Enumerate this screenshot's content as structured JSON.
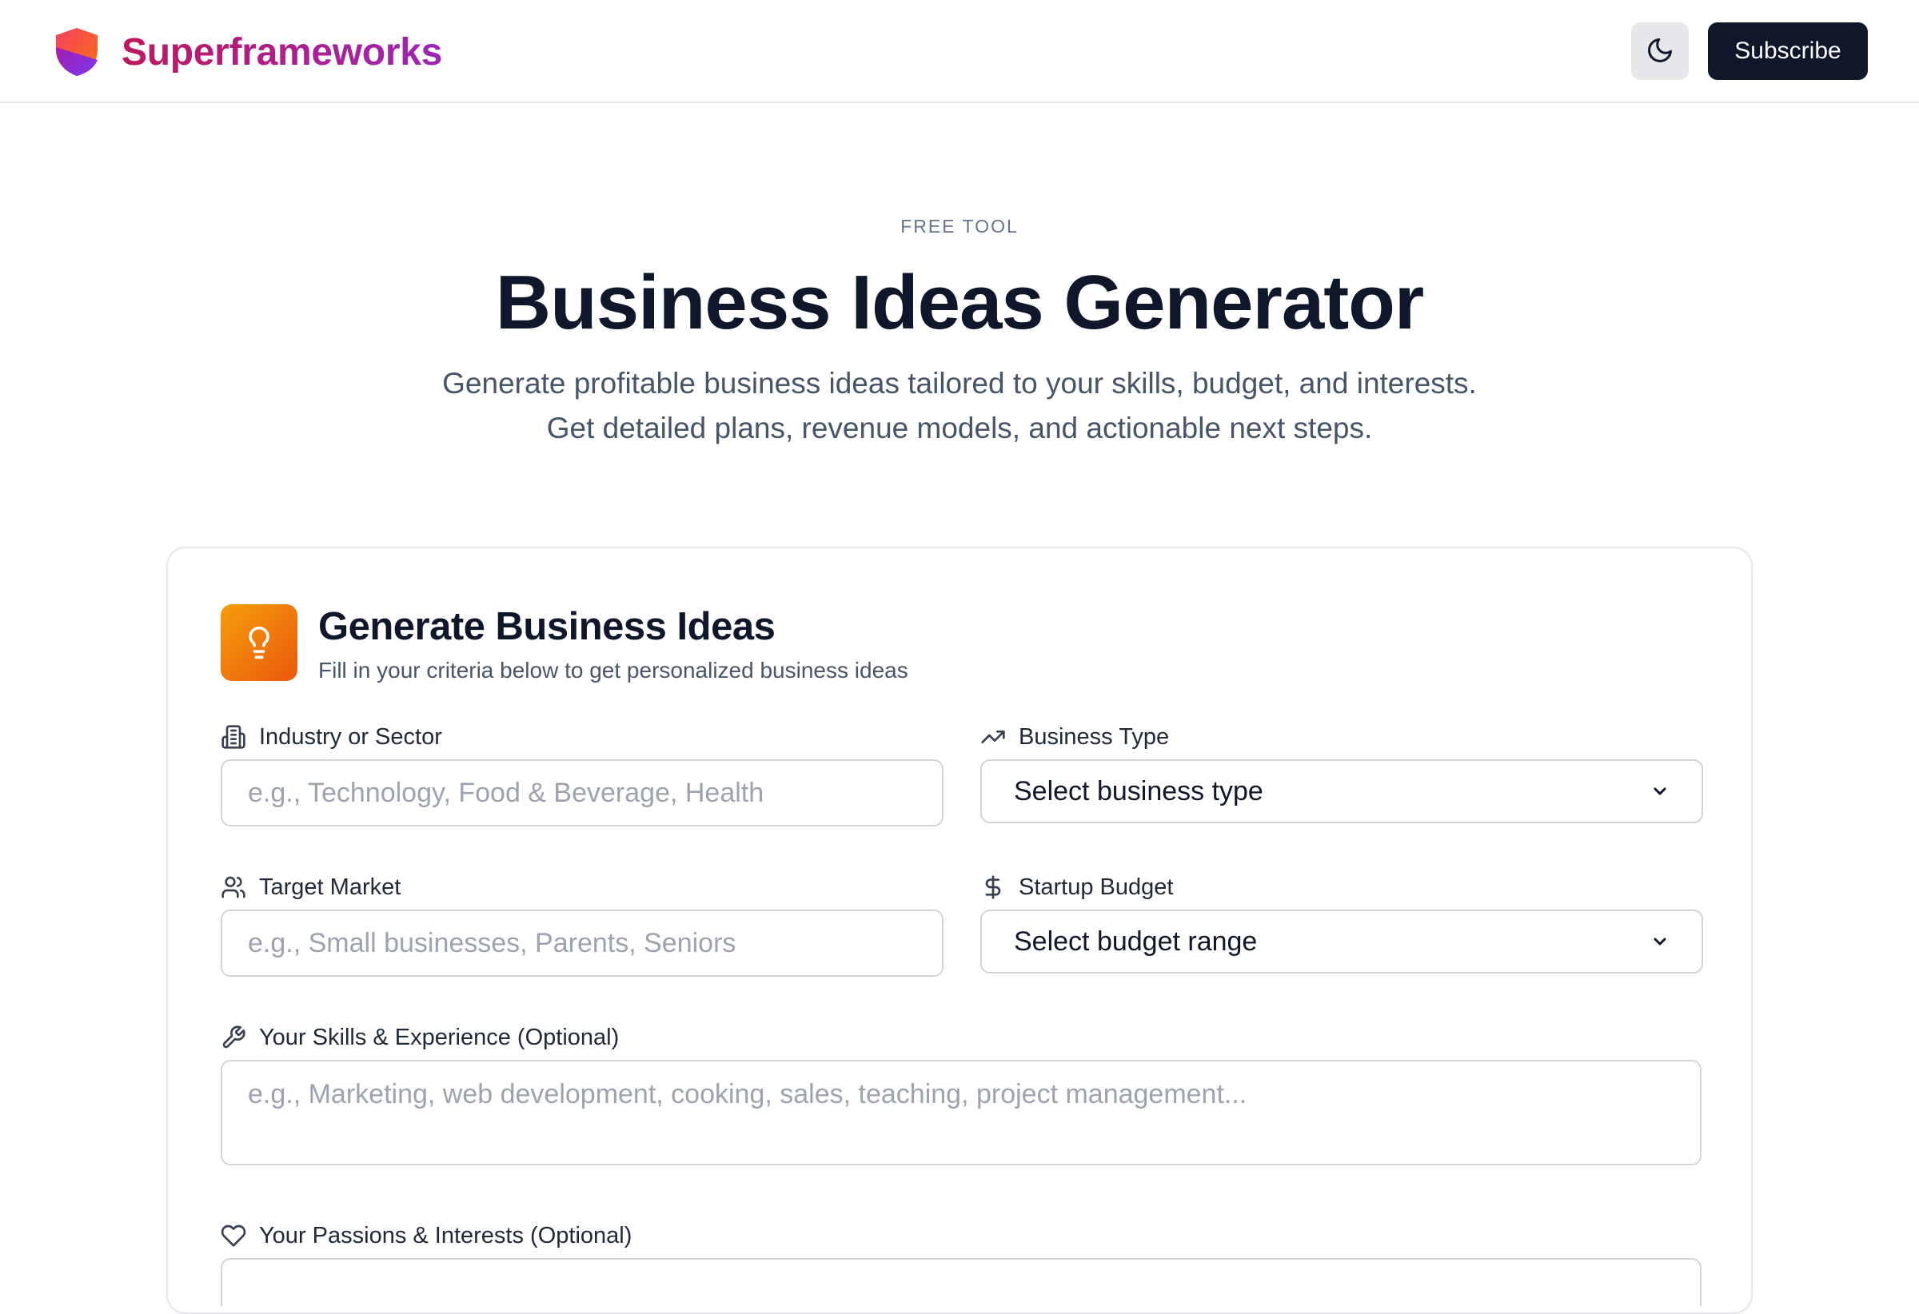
{
  "header": {
    "brand_name": "Superframeworks",
    "theme_toggle_icon": "moon-icon",
    "subscribe_label": "Subscribe"
  },
  "hero": {
    "eyebrow": "FREE TOOL",
    "title": "Business Ideas Generator",
    "subtitle_line1": "Generate profitable business ideas tailored to your skills, budget, and interests.",
    "subtitle_line2": "Get detailed plans, revenue models, and actionable next steps."
  },
  "form": {
    "title": "Generate Business Ideas",
    "subtitle": "Fill in your criteria below to get personalized business ideas",
    "header_icon": "lightbulb-icon",
    "fields": {
      "industry": {
        "label": "Industry or Sector",
        "icon": "building-icon",
        "placeholder": "e.g., Technology, Food & Beverage, Health",
        "value": ""
      },
      "business_type": {
        "label": "Business Type",
        "icon": "trending-up-icon",
        "selected": "Select business type"
      },
      "target_market": {
        "label": "Target Market",
        "icon": "users-icon",
        "placeholder": "e.g., Small businesses, Parents, Seniors",
        "value": ""
      },
      "startup_budget": {
        "label": "Startup Budget",
        "icon": "dollar-icon",
        "selected": "Select budget range"
      },
      "skills": {
        "label": "Your Skills & Experience (Optional)",
        "icon": "wrench-icon",
        "placeholder": "e.g., Marketing, web development, cooking, sales, teaching, project management...",
        "value": ""
      },
      "passions": {
        "label": "Your Passions & Interests (Optional)",
        "icon": "heart-icon"
      }
    }
  },
  "colors": {
    "brand_gradient_start": "#be185d",
    "brand_gradient_end": "#9d26b8",
    "primary_button": "#0f172a",
    "icon_gradient_start": "#f59e0b",
    "icon_gradient_end": "#ea580c"
  }
}
